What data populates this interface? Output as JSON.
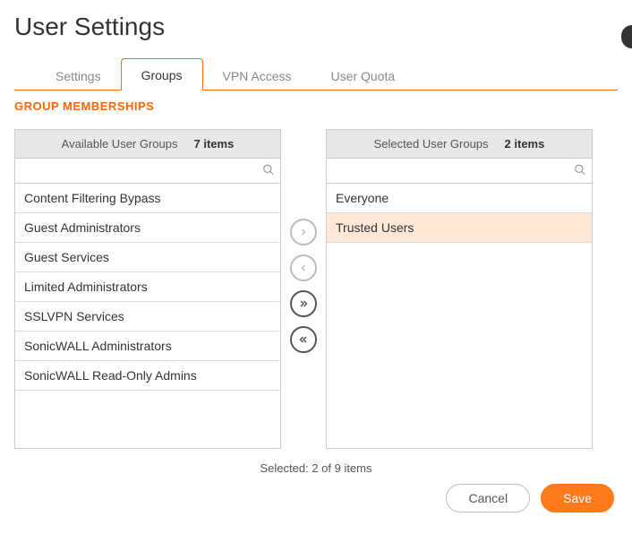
{
  "page": {
    "title": "User Settings"
  },
  "tabs": [
    {
      "label": "Settings"
    },
    {
      "label": "Groups"
    },
    {
      "label": "VPN Access"
    },
    {
      "label": "User Quota"
    }
  ],
  "activeTab": 1,
  "section": {
    "title": "GROUP MEMBERSHIPS"
  },
  "available": {
    "title": "Available User Groups",
    "count": "7 items",
    "items": [
      "Content Filtering Bypass",
      "Guest Administrators",
      "Guest Services",
      "Limited Administrators",
      "SSLVPN Services",
      "SonicWALL Administrators",
      "SonicWALL Read-Only Admins"
    ]
  },
  "selected": {
    "title": "Selected User Groups",
    "count": "2 items",
    "items": [
      "Everyone",
      "Trusted Users"
    ],
    "highlightIndex": 1
  },
  "summary": "Selected: 2 of 9 items",
  "buttons": {
    "cancel": "Cancel",
    "save": "Save"
  },
  "search": {
    "placeholder": ""
  }
}
